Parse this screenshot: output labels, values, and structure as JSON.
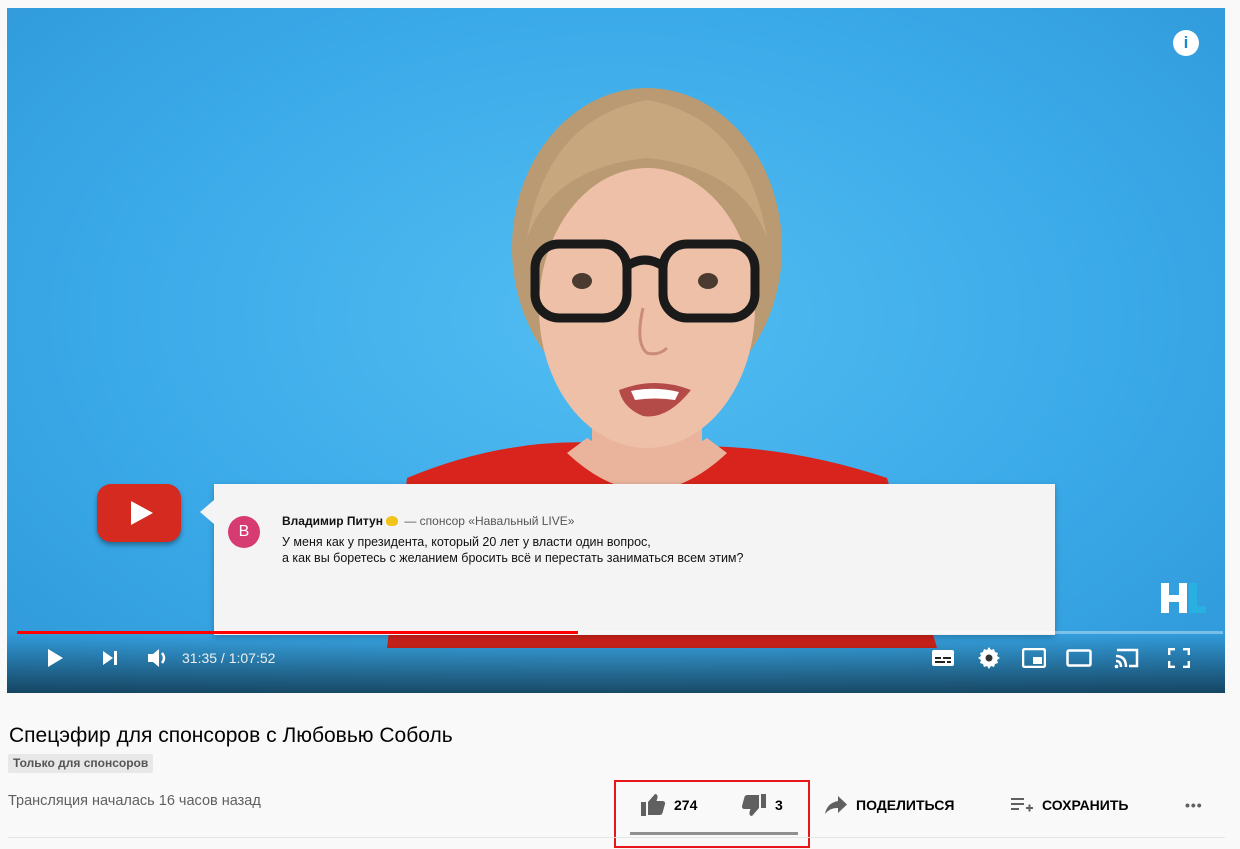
{
  "player": {
    "info_label": "i",
    "time_current": "31:35",
    "time_total": "1:07:52",
    "time_display": "31:35 / 1:07:52",
    "progress_played": 0.465,
    "progress_loaded": 0.47,
    "colors": {
      "progress_played": "#ff0000",
      "backdrop": "#3fb0ec"
    }
  },
  "overlay": {
    "avatar_letter": "В",
    "author": "Владимир Питун",
    "sponsor_text": "— спонсор «Навальный LIVE»",
    "comment_line1": "У меня как у президента, который 20 лет у власти один вопрос,",
    "comment_line2": "а как вы боретесь с желанием бросить всё и перестать заниматься всем этим?",
    "channel_logo_text": "HL"
  },
  "video": {
    "title": "Спецэфир для спонсоров с Любовью Соболь",
    "members_badge": "Только для спонсоров",
    "stream_info": "Трансляция началась 16 часов назад"
  },
  "actions": {
    "likes": "274",
    "dislikes": "3",
    "like_ratio": 0.989,
    "share_label": "ПОДЕЛИТЬСЯ",
    "save_label": "СОХРАНИТЬ",
    "more_label": "•••"
  },
  "highlight_color": "#e8161b"
}
